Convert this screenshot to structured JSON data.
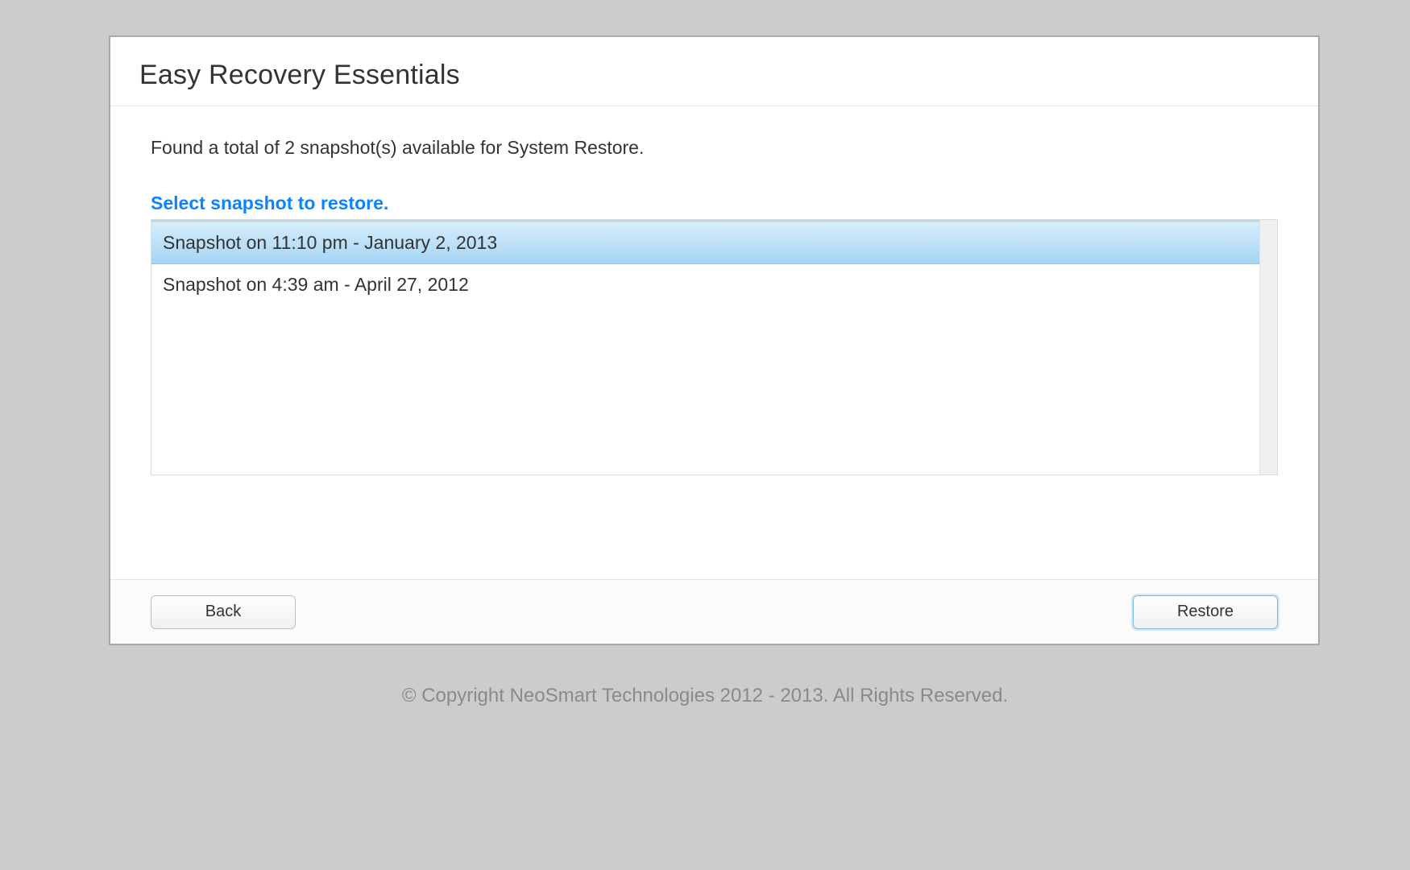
{
  "header": {
    "title": "Easy Recovery Essentials"
  },
  "content": {
    "status": "Found a total of 2 snapshot(s) available for System Restore.",
    "prompt": "Select snapshot to restore.",
    "snapshots": [
      {
        "label": "Snapshot on 11:10 pm - January 2, 2013",
        "selected": true
      },
      {
        "label": "Snapshot on 4:39 am - April 27, 2012",
        "selected": false
      }
    ]
  },
  "footer": {
    "back_label": "Back",
    "restore_label": "Restore"
  },
  "copyright": "© Copyright NeoSmart Technologies 2012 - 2013. All Rights Reserved."
}
